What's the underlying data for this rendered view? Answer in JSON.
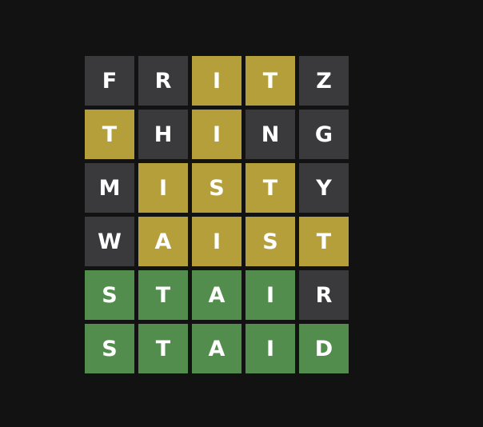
{
  "colors": {
    "background": "#121213",
    "absent": "#3a3a3c",
    "present": "#b59f3b",
    "correct": "#538d4e",
    "letter": "#ffffff"
  },
  "board": {
    "rows": [
      {
        "letters": [
          "F",
          "R",
          "I",
          "T",
          "Z"
        ],
        "states": [
          "absent",
          "absent",
          "present",
          "present",
          "absent"
        ]
      },
      {
        "letters": [
          "T",
          "H",
          "I",
          "N",
          "G"
        ],
        "states": [
          "present",
          "absent",
          "present",
          "absent",
          "absent"
        ]
      },
      {
        "letters": [
          "M",
          "I",
          "S",
          "T",
          "Y"
        ],
        "states": [
          "absent",
          "present",
          "present",
          "present",
          "absent"
        ]
      },
      {
        "letters": [
          "W",
          "A",
          "I",
          "S",
          "T"
        ],
        "states": [
          "absent",
          "present",
          "present",
          "present",
          "present"
        ]
      },
      {
        "letters": [
          "S",
          "T",
          "A",
          "I",
          "R"
        ],
        "states": [
          "correct",
          "correct",
          "correct",
          "correct",
          "absent"
        ]
      },
      {
        "letters": [
          "S",
          "T",
          "A",
          "I",
          "D"
        ],
        "states": [
          "correct",
          "correct",
          "correct",
          "correct",
          "correct"
        ]
      }
    ]
  }
}
